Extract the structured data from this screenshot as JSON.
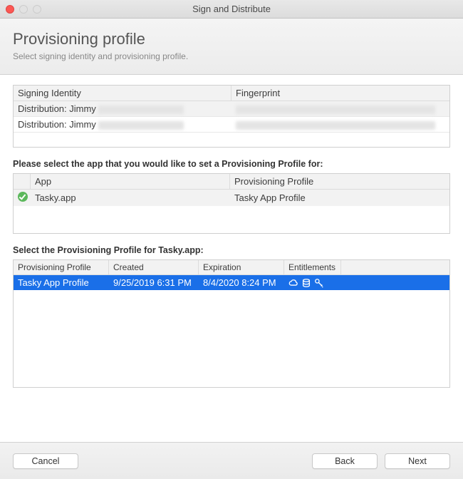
{
  "window": {
    "title": "Sign and Distribute"
  },
  "header": {
    "title": "Provisioning profile",
    "subtitle": "Select signing identity and provisioning profile."
  },
  "identity_table": {
    "columns": {
      "signing": "Signing Identity",
      "fingerprint": "Fingerprint"
    },
    "rows": [
      {
        "identity": "Distribution: Jimmy"
      },
      {
        "identity": "Distribution: Jimmy"
      }
    ]
  },
  "app_section": {
    "label": "Please select the app that you would like to set a Provisioning Profile for:",
    "columns": {
      "app": "App",
      "profile": "Provisioning Profile"
    },
    "rows": [
      {
        "app": "Tasky.app",
        "profile": "Tasky App Profile"
      }
    ]
  },
  "profile_section": {
    "label": "Select the Provisioning Profile for Tasky.app:",
    "columns": {
      "pp": "Provisioning Profile",
      "created": "Created",
      "exp": "Expiration",
      "ent": "Entitlements"
    },
    "rows": [
      {
        "pp": "Tasky App Profile",
        "created": "9/25/2019 6:31 PM",
        "exp": "8/4/2020 8:24 PM"
      }
    ]
  },
  "buttons": {
    "cancel": "Cancel",
    "back": "Back",
    "next": "Next"
  }
}
